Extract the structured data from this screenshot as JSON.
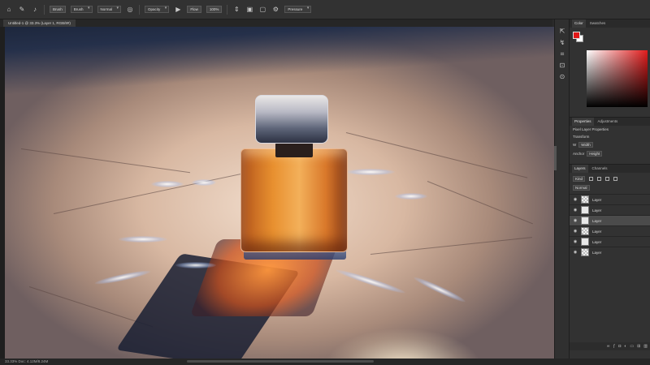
{
  "options_bar": {
    "items": [
      {
        "type": "icon",
        "icon": "home-icon",
        "glyph": "⌂"
      },
      {
        "type": "icon",
        "icon": "brush-tool-icon",
        "glyph": "✎"
      },
      {
        "type": "icon",
        "icon": "brush-preset-icon",
        "glyph": "♪"
      },
      {
        "type": "field",
        "value": "Brush"
      },
      {
        "type": "dropdown",
        "value": "Brush"
      },
      {
        "type": "dropdown",
        "value": "Normal"
      },
      {
        "type": "icon",
        "icon": "pressure-opacity-icon",
        "glyph": "◎"
      },
      {
        "type": "dropdown",
        "value": "Opacity"
      },
      {
        "type": "icon",
        "icon": "airbrush-icon",
        "glyph": "▶"
      },
      {
        "type": "field",
        "value": "Flow"
      },
      {
        "type": "field",
        "value": "100%"
      },
      {
        "type": "icon",
        "icon": "smoothing-icon",
        "glyph": "⇕"
      },
      {
        "type": "icon",
        "icon": "angle-icon",
        "glyph": "▣"
      },
      {
        "type": "icon",
        "icon": "symmetry-icon",
        "glyph": "▢"
      },
      {
        "type": "icon",
        "icon": "settings-icon",
        "glyph": "⚙"
      },
      {
        "type": "dropdown",
        "value": "Pressure"
      }
    ]
  },
  "document": {
    "tab_label": "Untitled-1 @ 33.3% (Layer 1, RGB/8#)"
  },
  "tools": [
    {
      "icon": "move-tool-icon",
      "glyph": "⇱"
    },
    {
      "icon": "lasso-tool-icon",
      "glyph": "↯"
    },
    {
      "icon": "crop-tool-icon",
      "glyph": "⌗"
    },
    {
      "icon": "eyedropper-tool-icon",
      "glyph": "⊡"
    },
    {
      "icon": "healing-tool-icon",
      "glyph": "⊙"
    }
  ],
  "color_panel": {
    "tabs": [
      "Color",
      "Swatches"
    ],
    "foreground": "#e01818",
    "background": "#ffffff"
  },
  "properties_panel": {
    "tabs": [
      "Properties",
      "Adjustments"
    ],
    "title": "Pixel Layer Properties",
    "subtitle": "Transform",
    "row1_label": "W",
    "row1_value": "Width",
    "row2_label": "Anchor",
    "row2_value": "Height"
  },
  "layers_panel": {
    "tabs": [
      "Layers",
      "Channels"
    ],
    "kind_filter": "Kind",
    "blend_mode": "Normal",
    "layers": [
      {
        "name": "Layer",
        "thumb": "checker",
        "selected": false
      },
      {
        "name": "Layer",
        "thumb": "white",
        "selected": false
      },
      {
        "name": "Layer",
        "thumb": "white",
        "selected": true
      },
      {
        "name": "Layer",
        "thumb": "checker",
        "selected": false
      },
      {
        "name": "Layer",
        "thumb": "white",
        "selected": false
      },
      {
        "name": "Layer",
        "thumb": "checker",
        "selected": false
      }
    ]
  },
  "status_bar": {
    "text": "33.33%   Doc: 4.12M/8.24M"
  },
  "colors": {
    "app_bg": "#2b2b2b",
    "panel_bg": "#323232",
    "accent_red": "#e01818"
  }
}
